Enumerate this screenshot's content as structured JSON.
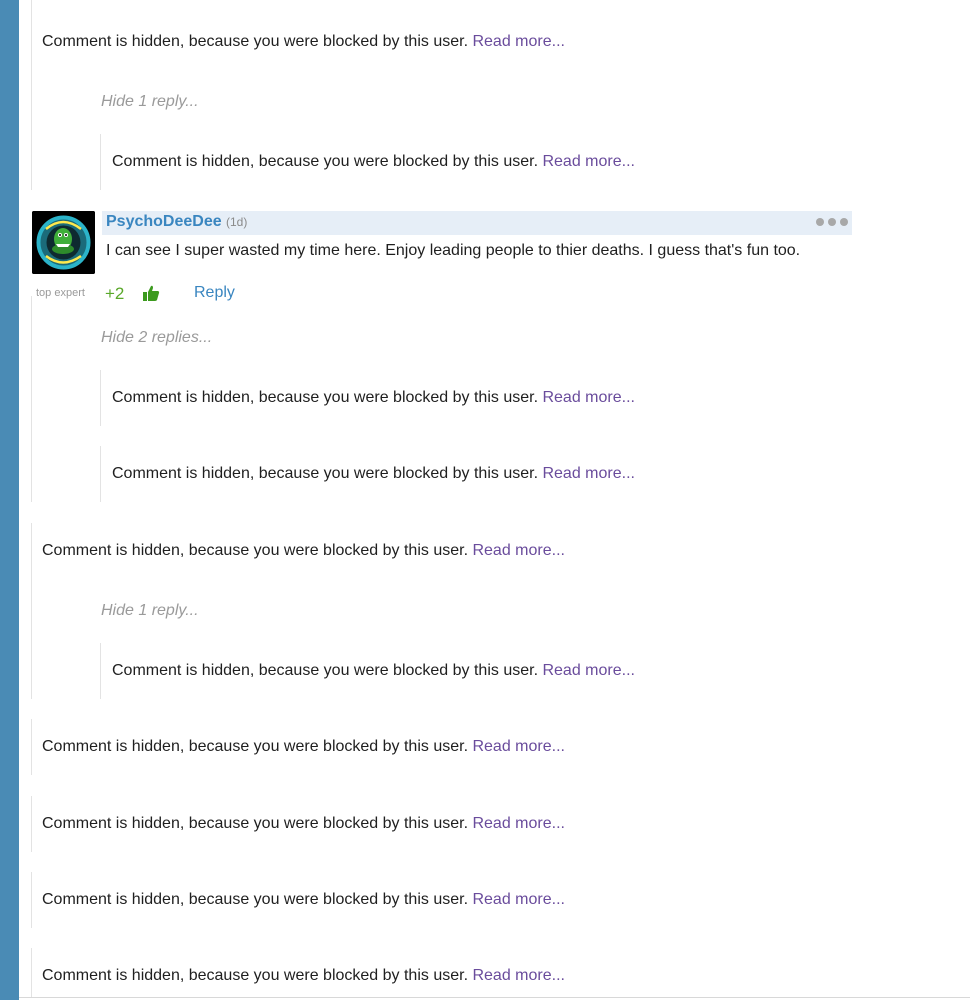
{
  "hidden_comment": {
    "text": "Comment is hidden, because you were blocked by this user.",
    "read_more": "Read more..."
  },
  "threads": {
    "hide_1_reply": "Hide 1 reply...",
    "hide_2_replies": "Hide 2 replies..."
  },
  "visible_comment": {
    "username": "PsychoDeeDee",
    "timestamp": "(1d)",
    "body": "I can see I super wasted my time here. Enjoy leading people to thier deaths. I guess that's fun too.",
    "badge": "top expert",
    "score": "+2",
    "reply_label": "Reply",
    "avatar_icon": "gator-logo-icon",
    "like_icon": "thumbs-up-icon",
    "more_icon": "more-dots-icon"
  },
  "colors": {
    "rail": "#4a8bb5",
    "link": "#6a4c9c",
    "username": "#3a86c0",
    "score": "#5aa82a",
    "header_bg": "#e6eef7"
  }
}
